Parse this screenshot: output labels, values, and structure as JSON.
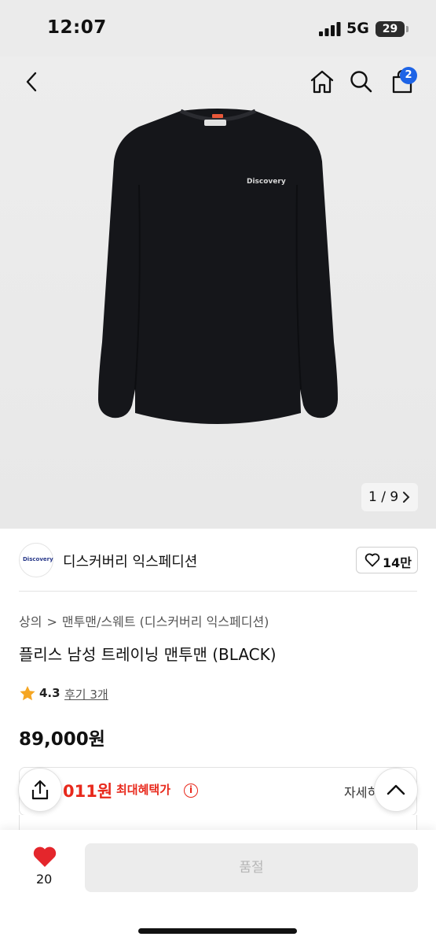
{
  "status_bar": {
    "time": "12:07",
    "network": "5G",
    "battery": "29",
    "icons": [
      "signal-icon",
      "battery-icon"
    ]
  },
  "nav": {
    "icons": [
      "back-icon",
      "home-icon",
      "search-icon",
      "cart-icon"
    ],
    "cart_count": "2"
  },
  "gallery": {
    "pager": "1 / 9",
    "image_logo_text": "Discovery"
  },
  "brand": {
    "logo_text": "Discovery",
    "name": "디스커버리 익스페디션",
    "likes": "14만"
  },
  "product": {
    "breadcrumb": [
      "상의",
      ">",
      "맨투맨/스웨트 (디스커버리 익스페디션)"
    ],
    "title": "플리스 남성 트레이닝 맨투맨 (BLACK)",
    "rating": "4.3",
    "reviews": "후기 3개",
    "price": "89,000원"
  },
  "benefit": {
    "price": "011원",
    "label": "최대혜택가",
    "info_icon": "i",
    "detail": "자세히"
  },
  "actions": {
    "share_icon": "share-icon",
    "scroll_top_icon": "chevron-up-icon"
  },
  "bottom_bar": {
    "wish_count": "20",
    "buy_label": "품절"
  },
  "colors": {
    "accent_red": "#e8291c",
    "badge_blue": "#1e64e6",
    "heart_red": "#e4262c",
    "star": "#f5a623"
  }
}
